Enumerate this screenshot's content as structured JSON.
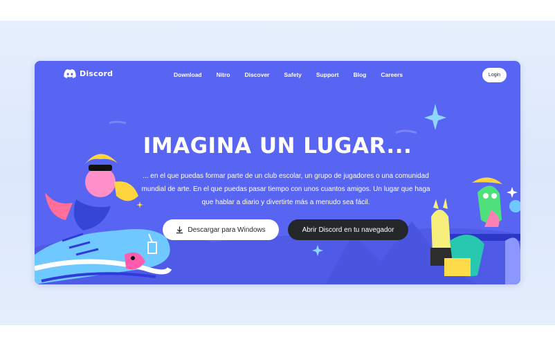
{
  "nav": {
    "brand": "Discord",
    "links": [
      "Download",
      "Nitro",
      "Discover",
      "Safety",
      "Support",
      "Blog",
      "Careers"
    ],
    "login_label": "Login"
  },
  "hero": {
    "headline": "IMAGINA UN LUGAR...",
    "lead": "... en el que puedas formar parte de un club escolar, un grupo de jugadores o una comunidad mundial de arte. En el que puedas pasar tiempo con unos cuantos amigos. Un lugar que haga que hablar a diario y divertirte más a menudo sea fácil.",
    "download_label": "Descargar para Windows",
    "browser_label": "Abrir Discord en tu navegador"
  },
  "colors": {
    "blurple": "#5865f2",
    "dark": "#23272a",
    "white": "#ffffff"
  },
  "icons": [
    "discord-logo-icon",
    "download-icon",
    "sparkle-icon"
  ]
}
